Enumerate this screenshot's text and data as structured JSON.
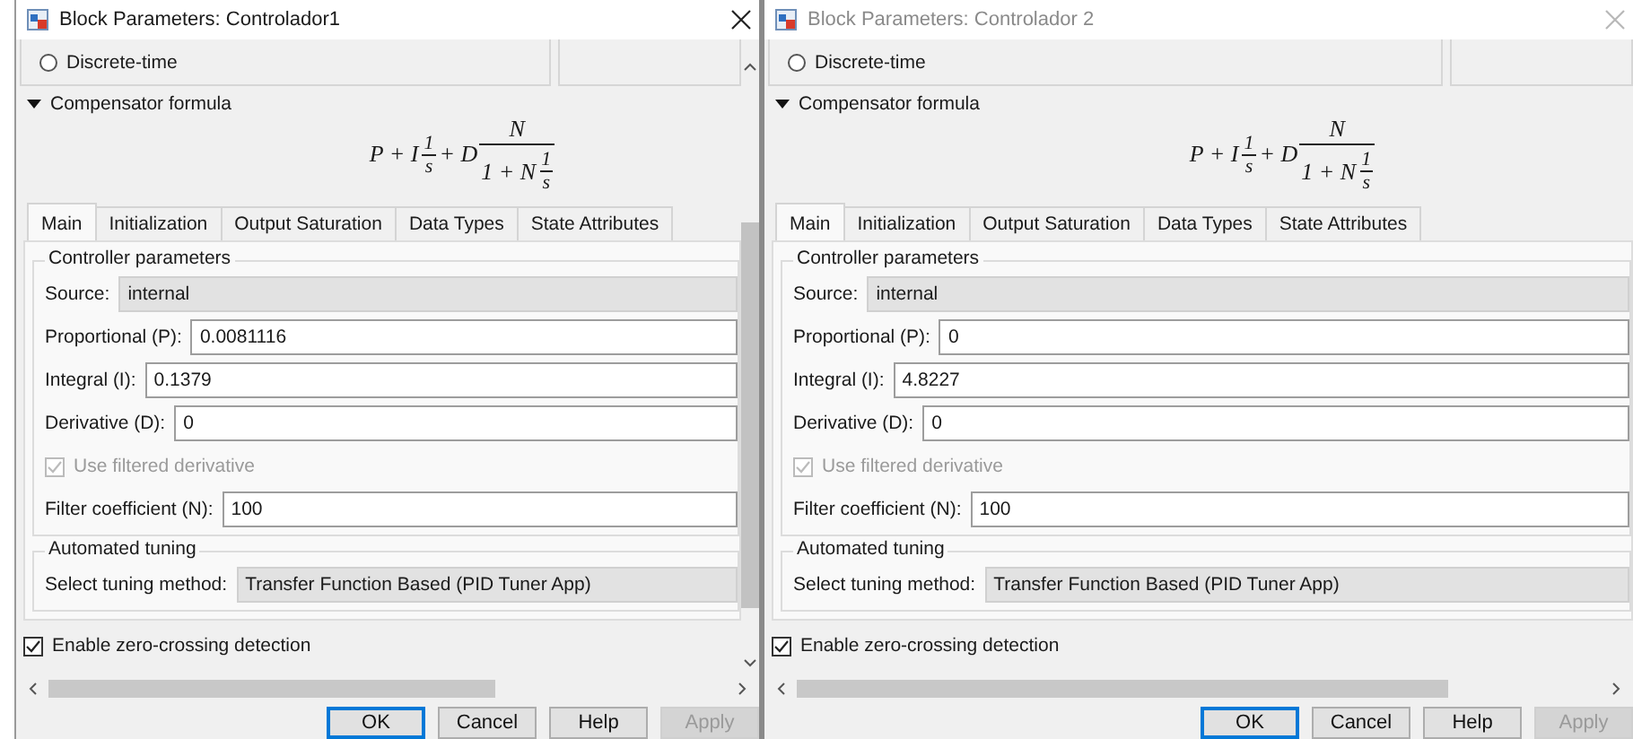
{
  "dialogs": [
    {
      "title": "Block Parameters: Controlador1",
      "active": true,
      "vertical_scrollbar": true,
      "time_option": {
        "label": "Discrete-time",
        "selected": false
      },
      "formula_section": {
        "label": "Compensator formula",
        "expanded": true
      },
      "formula": {
        "lead": "P + I",
        "f1_num": "1",
        "f1_den": "s",
        "mid": "+ D",
        "f2_num": "N",
        "f2_den_lead": "1 + N",
        "f2_den_num": "1",
        "f2_den_den": "s"
      },
      "tabs": [
        {
          "label": "Main",
          "selected": true
        },
        {
          "label": "Initialization",
          "selected": false
        },
        {
          "label": "Output Saturation",
          "selected": false
        },
        {
          "label": "Data Types",
          "selected": false
        },
        {
          "label": "State Attributes",
          "selected": false
        }
      ],
      "controller_group": {
        "title": "Controller parameters",
        "rows": [
          {
            "kind": "readonly",
            "label": "Source:",
            "value": "internal"
          },
          {
            "kind": "input",
            "label": "Proportional (P):",
            "value": "0.0081116"
          },
          {
            "kind": "input",
            "label": "Integral (I):",
            "value": "0.1379"
          },
          {
            "kind": "input",
            "label": "Derivative (D):",
            "value": "0"
          },
          {
            "kind": "checkbox",
            "label": "Use filtered derivative",
            "checked": true,
            "disabled": true
          },
          {
            "kind": "input",
            "label": "Filter coefficient (N):",
            "value": "100"
          }
        ]
      },
      "tuning_group": {
        "title": "Automated tuning",
        "label": "Select tuning method:",
        "value": "Transfer Function Based (PID Tuner App)"
      },
      "zero_crossing": {
        "label": "Enable zero-crossing detection",
        "checked": true
      },
      "buttons": [
        {
          "label": "OK",
          "default": true,
          "disabled": false
        },
        {
          "label": "Cancel",
          "default": false,
          "disabled": false
        },
        {
          "label": "Help",
          "default": false,
          "disabled": false
        },
        {
          "label": "Apply",
          "default": false,
          "disabled": true
        }
      ]
    },
    {
      "title": "Block Parameters: Controlador 2",
      "active": false,
      "vertical_scrollbar": false,
      "time_option": {
        "label": "Discrete-time",
        "selected": false
      },
      "formula_section": {
        "label": "Compensator formula",
        "expanded": true
      },
      "formula": {
        "lead": "P + I",
        "f1_num": "1",
        "f1_den": "s",
        "mid": "+ D",
        "f2_num": "N",
        "f2_den_lead": "1 + N",
        "f2_den_num": "1",
        "f2_den_den": "s"
      },
      "tabs": [
        {
          "label": "Main",
          "selected": true
        },
        {
          "label": "Initialization",
          "selected": false
        },
        {
          "label": "Output Saturation",
          "selected": false
        },
        {
          "label": "Data Types",
          "selected": false
        },
        {
          "label": "State Attributes",
          "selected": false
        }
      ],
      "controller_group": {
        "title": "Controller parameters",
        "rows": [
          {
            "kind": "readonly",
            "label": "Source:",
            "value": "internal"
          },
          {
            "kind": "input",
            "label": "Proportional (P):",
            "value": "0"
          },
          {
            "kind": "input",
            "label": "Integral (I):",
            "value": "4.8227"
          },
          {
            "kind": "input",
            "label": "Derivative (D):",
            "value": "0"
          },
          {
            "kind": "checkbox",
            "label": "Use filtered derivative",
            "checked": true,
            "disabled": true
          },
          {
            "kind": "input",
            "label": "Filter coefficient (N):",
            "value": "100"
          }
        ]
      },
      "tuning_group": {
        "title": "Automated tuning",
        "label": "Select tuning method:",
        "value": "Transfer Function Based (PID Tuner App)"
      },
      "zero_crossing": {
        "label": "Enable zero-crossing detection",
        "checked": true
      },
      "buttons": [
        {
          "label": "OK",
          "default": true,
          "disabled": false
        },
        {
          "label": "Cancel",
          "default": false,
          "disabled": false
        },
        {
          "label": "Help",
          "default": false,
          "disabled": false
        },
        {
          "label": "Apply",
          "default": false,
          "disabled": true
        }
      ]
    }
  ]
}
